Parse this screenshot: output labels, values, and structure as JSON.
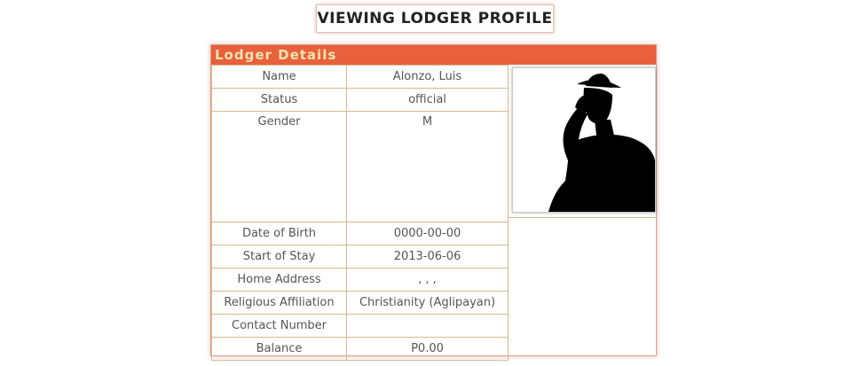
{
  "page": {
    "title": "VIEWING LODGER PROFILE"
  },
  "card": {
    "header": "Lodger Details"
  },
  "details": [
    {
      "label": "Name",
      "value": "Alonzo, Luis"
    },
    {
      "label": "Status",
      "value": "official"
    },
    {
      "label": "Gender",
      "value": "M"
    },
    {
      "label": "Date of Birth",
      "value": "0000-00-00"
    },
    {
      "label": "Start of Stay",
      "value": "2013-06-06"
    },
    {
      "label": "Home Address",
      "value": ", , ,"
    },
    {
      "label": "Religious Affiliation",
      "value": "Christianity (Aglipayan)"
    },
    {
      "label": "Contact Number",
      "value": ""
    },
    {
      "label": "Balance",
      "value": "P0.00"
    }
  ],
  "photo": {
    "icon": "person-silhouette-icon"
  },
  "colors": {
    "header_bg": "#e8603c",
    "header_text": "#f5e3b0",
    "border": "#d7b88a"
  }
}
